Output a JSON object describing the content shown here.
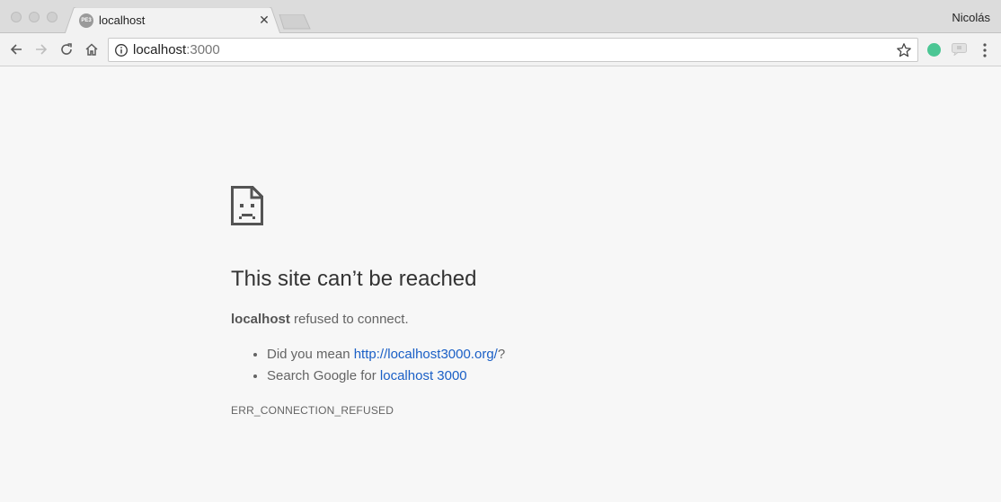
{
  "browser": {
    "tab": {
      "title": "localhost",
      "favicon_text": "PE3"
    },
    "profile_name": "Nicolás",
    "omnibox": {
      "host": "localhost",
      "port": ":3000"
    },
    "icons": [
      "back-icon",
      "forward-icon",
      "reload-icon",
      "home-icon",
      "info-icon",
      "star-icon",
      "extension-icon",
      "menu-icon"
    ],
    "colors": {
      "extension_green": "#4bc694",
      "link": "#1a5fc6"
    }
  },
  "error_page": {
    "heading": "This site can’t be reached",
    "message_host": "localhost",
    "message_rest": " refused to connect.",
    "suggestion_1_prefix": "Did you mean ",
    "suggestion_1_link": "http://localhost3000.org/",
    "suggestion_1_suffix": "?",
    "suggestion_2_prefix": "Search Google for ",
    "suggestion_2_link": "localhost 3000",
    "error_code": "ERR_CONNECTION_REFUSED"
  }
}
